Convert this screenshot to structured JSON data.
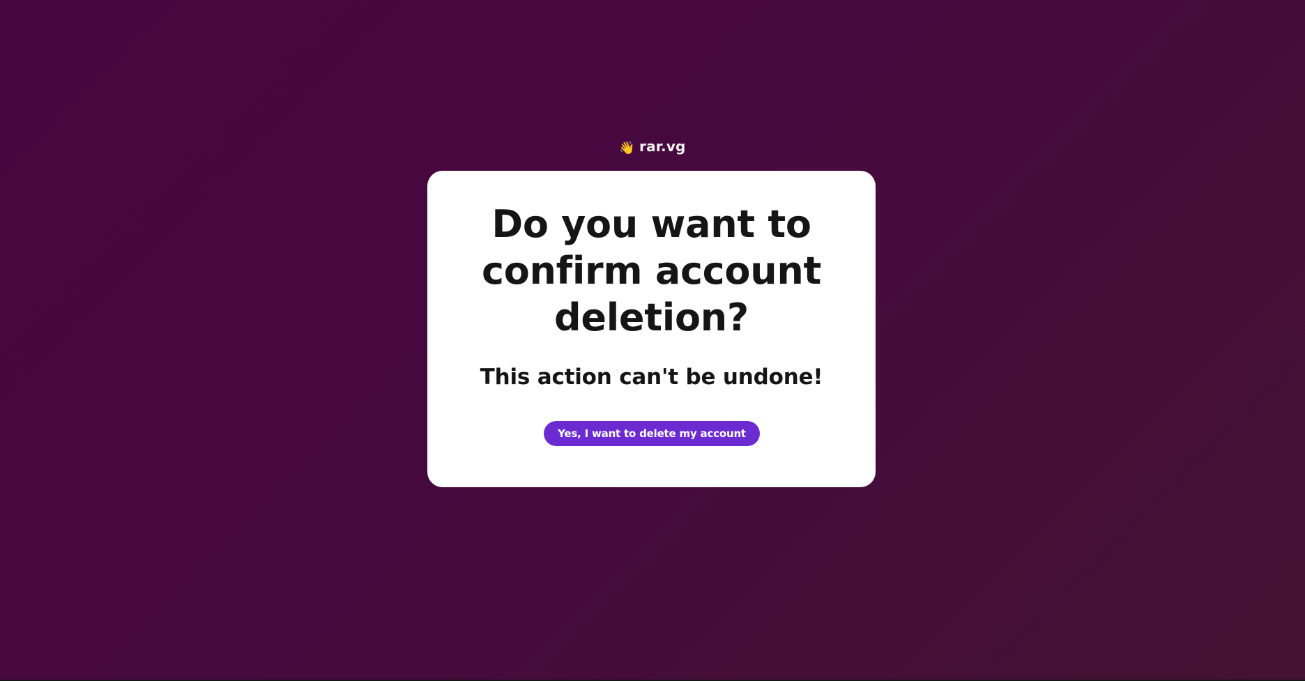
{
  "brand": {
    "icon": "waving-hand-icon",
    "icon_glyph": "👋",
    "name": "rar.vg"
  },
  "dialog": {
    "title": "Do you want to confirm account deletion?",
    "subtitle": "This action can't be undone!",
    "confirm_button_label": "Yes, I want to delete my account"
  },
  "colors": {
    "background_start": "#47063f",
    "background_end": "#441232",
    "card_background": "#ffffff",
    "text": "#151515",
    "accent": "#6b2bd1",
    "brand_text": "#f2f2f2"
  }
}
